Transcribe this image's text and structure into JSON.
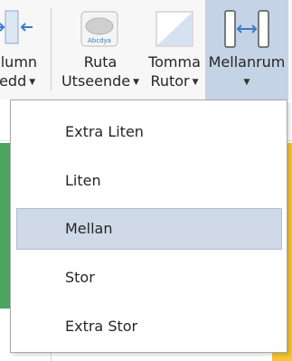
{
  "ribbon": {
    "column_width": {
      "icon": "column-width-icon",
      "label_line1": "olumn",
      "label_line2": "redd"
    },
    "cell_appearance": {
      "icon": "cell-style-icon",
      "icon_text": "Abcdya",
      "label_line1": "Ruta",
      "label_line2": "Utseende"
    },
    "empty_cells": {
      "icon": "empty-cells-icon",
      "label_line1": "Tomma",
      "label_line2": "Rutor"
    },
    "spacing": {
      "icon": "spacing-icon",
      "label_line1": "Mellanrum",
      "active": true
    }
  },
  "menu": {
    "items": [
      {
        "label": "Extra Liten",
        "selected": false
      },
      {
        "label": "Liten",
        "selected": false
      },
      {
        "label": "Mellan",
        "selected": true
      },
      {
        "label": "Stor",
        "selected": false
      },
      {
        "label": "Extra Stor",
        "selected": false
      }
    ]
  },
  "colors": {
    "ribbon_active": "#c5d3e6",
    "menu_selected": "#cfd9e8",
    "sheet_green": "#4ba560",
    "sheet_yellow": "#f6c52f",
    "accent_blue": "#3b7ac9"
  }
}
